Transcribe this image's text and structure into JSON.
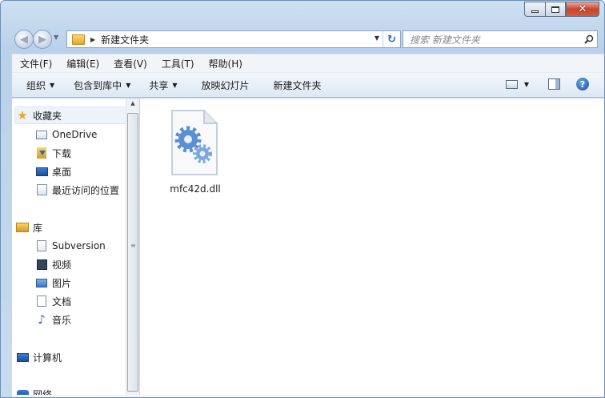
{
  "window": {
    "controls": {
      "minimize_icon": "minimize-icon",
      "maximize_icon": "maximize-icon",
      "close_label": "✕"
    }
  },
  "address": {
    "path": "新建文件夹",
    "search_placeholder": "搜索 新建文件夹"
  },
  "menubar": {
    "items": [
      "文件(F)",
      "编辑(E)",
      "查看(V)",
      "工具(T)",
      "帮助(H)"
    ]
  },
  "commandbar": {
    "items": [
      "组织",
      "包含到库中",
      "共享",
      "放映幻灯片",
      "新建文件夹"
    ]
  },
  "navpane": {
    "favorites": {
      "label": "收藏夹",
      "items": [
        "OneDrive",
        "下载",
        "桌面",
        "最近访问的位置"
      ]
    },
    "libraries": {
      "label": "库",
      "items": [
        "Subversion",
        "视频",
        "图片",
        "文档",
        "音乐"
      ]
    },
    "computer": "计算机",
    "network": "网络"
  },
  "files": [
    {
      "name": "mfc42d.dll",
      "icon": "dll-file-icon"
    }
  ]
}
